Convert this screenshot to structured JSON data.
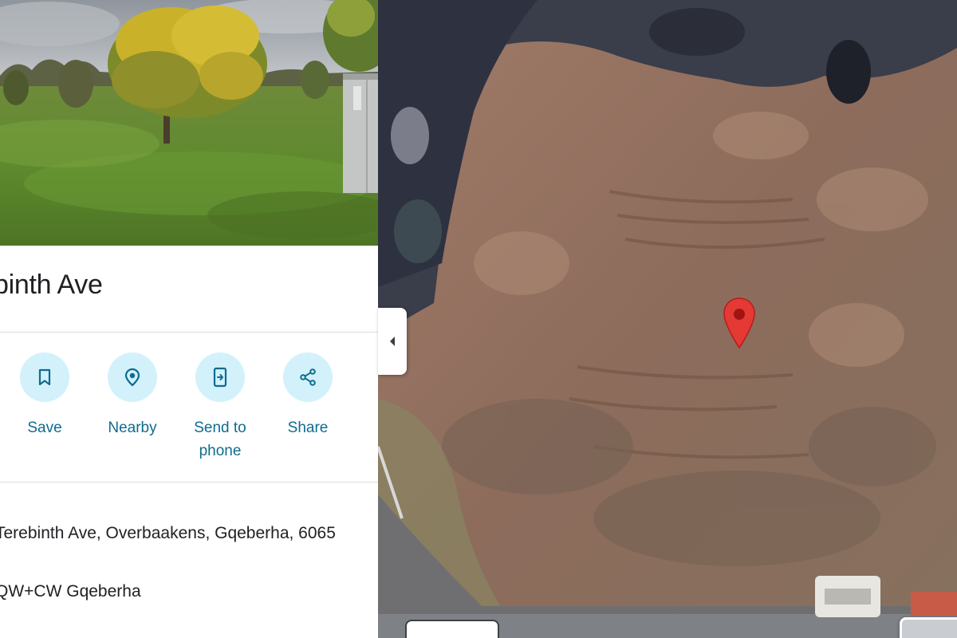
{
  "place": {
    "title": "binth Ave"
  },
  "actions": [
    {
      "label": "Save",
      "icon": "bookmark-icon"
    },
    {
      "label": "Nearby",
      "icon": "nearby-icon"
    },
    {
      "label": "Send to\nphone",
      "icon": "send-to-phone-icon"
    },
    {
      "label": "Share",
      "icon": "share-icon"
    }
  ],
  "info": {
    "address": "Terebinth Ave, Overbaakens, Gqeberha, 6065",
    "plus_code": "QW+CW Gqeberha"
  },
  "colors": {
    "accent_text": "#0f6c8e",
    "action_circle": "#d2f1fb",
    "pin": "#e53935",
    "divider": "#dadce0"
  },
  "map": {
    "view": "satellite",
    "marker_icon": "map-pin-icon"
  }
}
